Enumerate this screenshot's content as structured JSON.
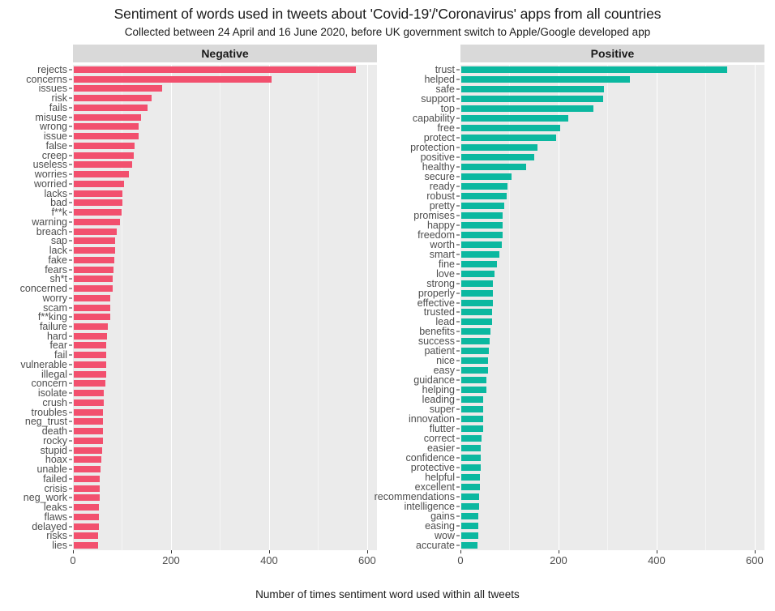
{
  "header": {
    "title": "Sentiment of words used in tweets about 'Covid-19'/'Coronavirus' apps from all countries",
    "subtitle": "Collected between 24 April and 16 June 2020, before UK government switch to Apple/Google developed app"
  },
  "axis": {
    "x_title": "Number of times sentiment word used within all tweets",
    "x_ticks": [
      "0",
      "200",
      "400",
      "600"
    ]
  },
  "panels": {
    "negative_label": "Negative",
    "positive_label": "Positive"
  },
  "colors": {
    "negative_bar": "#f2506e",
    "positive_bar": "#0bb8a0",
    "panel_background": "#ebebeb",
    "strip_background": "#d9d9d9",
    "gridline": "#ffffff"
  },
  "chart_data": {
    "type": "bar",
    "orientation": "horizontal",
    "title": "Sentiment of words used in tweets about 'Covid-19'/'Coronavirus' apps from all countries",
    "subtitle": "Collected between 24 April and 16 June 2020, before UK government switch to Apple/Google developed app",
    "xlabel": "Number of times sentiment word used within all tweets",
    "ylabel": "",
    "xlim": [
      0,
      620
    ],
    "xticks": [
      0,
      200,
      400,
      600
    ],
    "grid": true,
    "legend": "none",
    "facets": [
      {
        "name": "Negative",
        "color": "#f2506e",
        "categories": [
          "rejects",
          "concerns",
          "issues",
          "risk",
          "fails",
          "misuse",
          "wrong",
          "issue",
          "false",
          "creep",
          "useless",
          "worries",
          "worried",
          "lacks",
          "bad",
          "f**k",
          "warning",
          "breach",
          "sap",
          "lack",
          "fake",
          "fears",
          "sh*t",
          "concerned",
          "worry",
          "scam",
          "f**king",
          "failure",
          "hard",
          "fear",
          "fail",
          "vulnerable",
          "illegal",
          "concern",
          "isolate",
          "crush",
          "troubles",
          "neg_trust",
          "death",
          "rocky",
          "stupid",
          "hoax",
          "unable",
          "failed",
          "crisis",
          "neg_work",
          "leaks",
          "flaws",
          "delayed",
          "risks",
          "lies"
        ],
        "values": [
          576,
          403,
          181,
          159,
          150,
          138,
          133,
          132,
          124,
          123,
          119,
          113,
          103,
          100,
          99,
          98,
          94,
          87,
          85,
          85,
          82,
          81,
          80,
          79,
          75,
          74,
          74,
          70,
          67,
          66,
          66,
          66,
          66,
          64,
          61,
          61,
          60,
          60,
          60,
          60,
          58,
          57,
          55,
          53,
          53,
          53,
          51,
          51,
          51,
          50,
          50
        ]
      },
      {
        "name": "Positive",
        "color": "#0bb8a0",
        "categories": [
          "trust",
          "helped",
          "safe",
          "support",
          "top",
          "capability",
          "free",
          "protect",
          "protection",
          "positive",
          "healthy",
          "secure",
          "ready",
          "robust",
          "pretty",
          "promises",
          "happy",
          "freedom",
          "worth",
          "smart",
          "fine",
          "love",
          "strong",
          "properly",
          "effective",
          "trusted",
          "lead",
          "benefits",
          "success",
          "patient",
          "nice",
          "easy",
          "guidance",
          "helping",
          "leading",
          "super",
          "innovation",
          "flutter",
          "correct",
          "easier",
          "confidence",
          "protective",
          "helpful",
          "excellent",
          "recommendations",
          "intelligence",
          "gains",
          "easing",
          "wow",
          "accurate"
        ],
        "values": [
          543,
          344,
          291,
          290,
          269,
          218,
          201,
          194,
          155,
          148,
          133,
          102,
          94,
          92,
          88,
          85,
          85,
          84,
          82,
          78,
          73,
          67,
          65,
          64,
          64,
          62,
          62,
          60,
          58,
          56,
          55,
          55,
          51,
          51,
          45,
          45,
          45,
          44,
          41,
          40,
          39,
          39,
          38,
          38,
          37,
          36,
          35,
          35,
          35,
          33
        ]
      }
    ]
  }
}
